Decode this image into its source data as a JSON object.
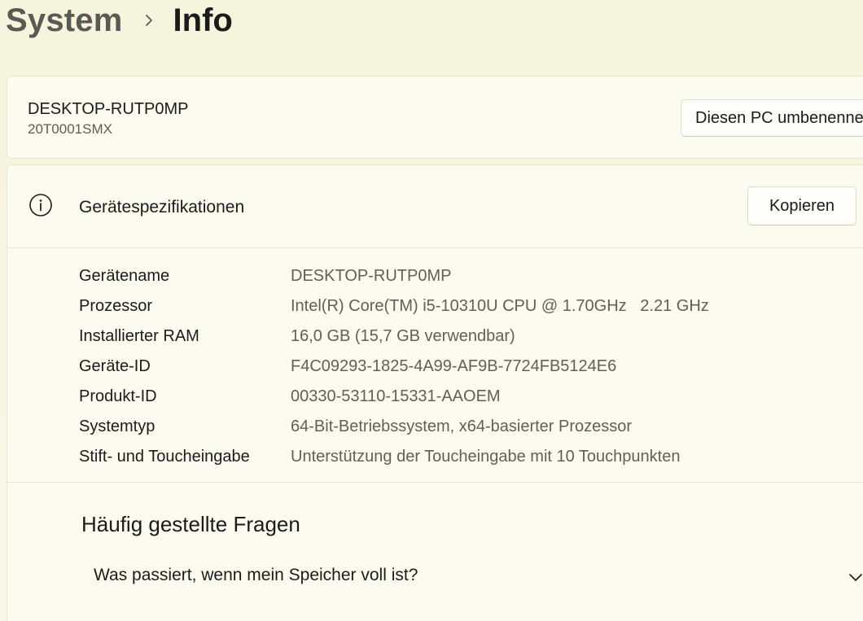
{
  "breadcrumb": {
    "parent": "System",
    "separator_icon": "chevron-right-icon",
    "current": "Info"
  },
  "device_card": {
    "name": "DESKTOP-RUTP0MP",
    "model": "20T0001SMX",
    "rename_label": "Diesen PC umbenennen"
  },
  "specs": {
    "icon": "info-icon",
    "title": "Gerätespezifikationen",
    "copy_label": "Kopieren",
    "rows": [
      {
        "label": "Gerätename",
        "value": "DESKTOP-RUTP0MP"
      },
      {
        "label": "Prozessor",
        "value": "Intel(R) Core(TM) i5-10310U CPU @ 1.70GHz   2.21 GHz"
      },
      {
        "label": "Installierter RAM",
        "value": "16,0 GB (15,7 GB verwendbar)"
      },
      {
        "label": "Geräte-ID",
        "value": "F4C09293-1825-4A99-AF9B-7724FB5124E6"
      },
      {
        "label": "Produkt-ID",
        "value": "00330-53110-15331-AAOEM"
      },
      {
        "label": "Systemtyp",
        "value": "64-Bit-Betriebssystem, x64-basierter Prozessor"
      },
      {
        "label": "Stift- und Toucheingabe",
        "value": "Unterstützung der Toucheingabe mit 10 Touchpunkten"
      }
    ]
  },
  "faq": {
    "title": "Häufig gestellte Fragen",
    "items": [
      {
        "question": "Was passiert, wenn mein Speicher voll ist?",
        "icon": "chevron-down-icon"
      }
    ]
  },
  "colors": {
    "background": "#f5f6de",
    "card": "#fbfbef",
    "text_primary": "#1b1b1b",
    "text_secondary": "#606058"
  }
}
